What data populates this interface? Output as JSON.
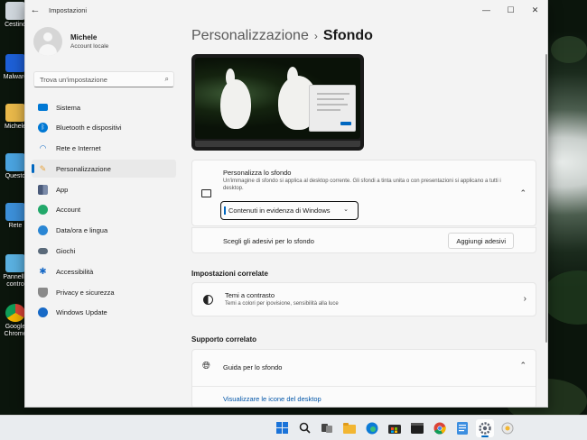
{
  "window": {
    "title": "Impostazioni",
    "back_glyph": "←",
    "controls": {
      "minimize": "—",
      "maximize": "☐",
      "close": "✕"
    }
  },
  "desktop": {
    "icons": [
      "Cestino",
      "Malware",
      "Michele",
      "Questo",
      "Rete",
      "Pannello contro",
      "Google Chrome"
    ]
  },
  "profile": {
    "name": "Michele",
    "account_type": "Account locale"
  },
  "search": {
    "placeholder": "Trova un'impostazione",
    "icon": "search-icon"
  },
  "nav": [
    {
      "label": "Sistema",
      "icon": "monitor-icon",
      "color": "#0078d4"
    },
    {
      "label": "Bluetooth e dispositivi",
      "icon": "bluetooth-icon",
      "color": "#0078d4"
    },
    {
      "label": "Rete e Internet",
      "icon": "wifi-icon",
      "color": "#1b6fc5"
    },
    {
      "label": "Personalizzazione",
      "icon": "brush-icon",
      "color": "#e8a33c",
      "active": true
    },
    {
      "label": "App",
      "icon": "apps-icon",
      "color": "#4a5a7a"
    },
    {
      "label": "Account",
      "icon": "person-icon",
      "color": "#22a86a"
    },
    {
      "label": "Data/ora e lingua",
      "icon": "globe-clock-icon",
      "color": "#2a86d4"
    },
    {
      "label": "Giochi",
      "icon": "gamepad-icon",
      "color": "#5a6a7a"
    },
    {
      "label": "Accessibilità",
      "icon": "accessibility-icon",
      "color": "#1769c6"
    },
    {
      "label": "Privacy e sicurezza",
      "icon": "shield-icon",
      "color": "#7a7a7a"
    },
    {
      "label": "Windows Update",
      "icon": "update-icon",
      "color": "#1769c6"
    }
  ],
  "breadcrumb": {
    "parent": "Personalizzazione",
    "separator": "›",
    "current": "Sfondo"
  },
  "background_card": {
    "title": "Personalizza lo sfondo",
    "description": "Un'immagine di sfondo si applica al desktop corrente. Gli sfondi a tinta unita o con presentazioni si applicano a tutti i desktop.",
    "selected": "Contenuti in evidenza di Windows",
    "chevron": "⌃"
  },
  "stickers_card": {
    "label": "Scegli gli adesivi per lo sfondo",
    "button": "Aggiungi adesivi"
  },
  "related": {
    "title": "Impostazioni correlate",
    "contrast_title": "Temi a contrasto",
    "contrast_desc": "Temi a colori per ipovisione, sensibilità alla luce",
    "chevron": "›"
  },
  "support": {
    "title": "Supporto correlato",
    "help_title": "Guida per lo sfondo",
    "help_link": "Visualizzare le icone del desktop",
    "chevron": "⌃"
  },
  "taskbar": {
    "icons": [
      "windows-start-icon",
      "search-icon",
      "task-view-icon",
      "file-explorer-icon",
      "edge-icon",
      "store-icon",
      "terminal-icon",
      "chrome-icon",
      "notepad-icon",
      "settings-icon",
      "snipping-icon"
    ],
    "active": "settings-icon"
  }
}
